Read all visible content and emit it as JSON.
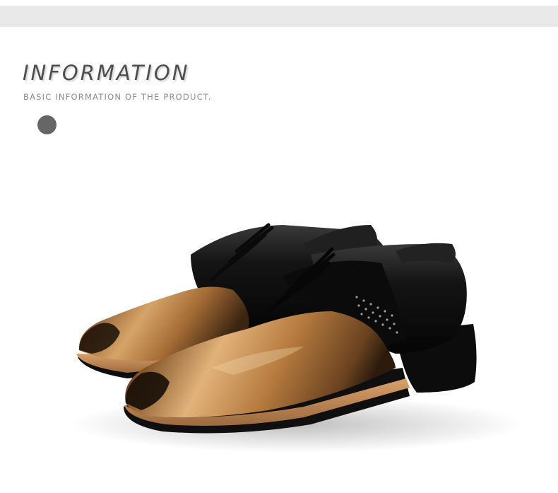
{
  "header": {
    "title": "INFORMATION",
    "subtitle": "BASIC INFORMATION OF THE PRODUCT."
  },
  "image": {
    "icon": "product-photo-shoes"
  },
  "colors": {
    "bar": "#e9e9e9",
    "title": "#4d4d4d",
    "subtitle": "#8c8c8c",
    "dot": "#666666",
    "leather_black": "#111111",
    "leather_bronze": "#b07a3e"
  }
}
